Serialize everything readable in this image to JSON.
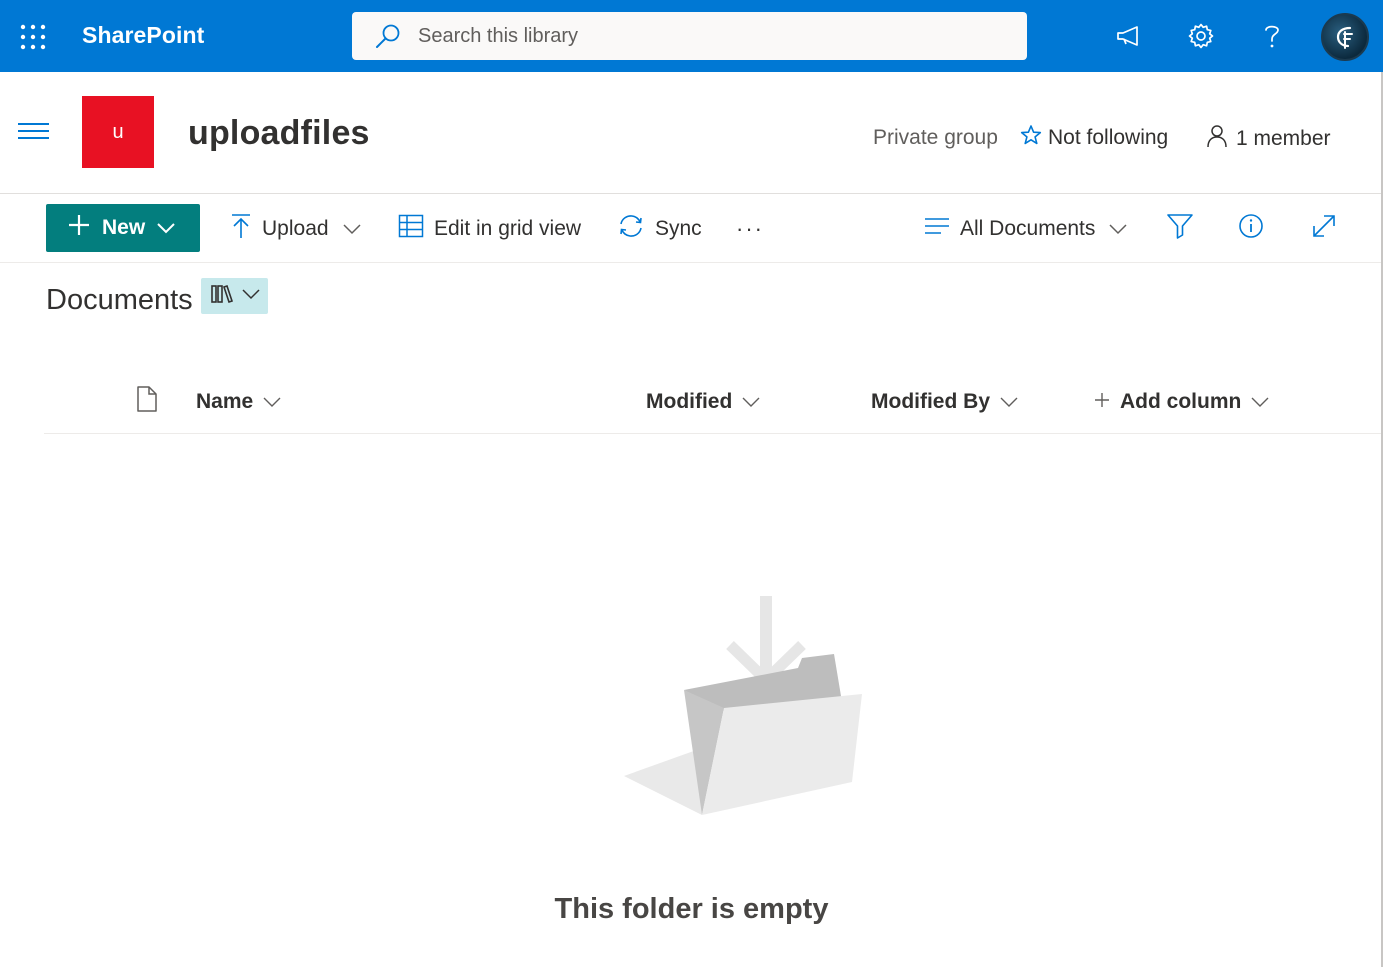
{
  "suite_bar": {
    "app_name": "SharePoint",
    "search_placeholder": "Search this library",
    "icons": [
      "waffle-icon",
      "megaphone-icon",
      "gear-icon",
      "help-icon",
      "avatar"
    ],
    "color": "#0078d4"
  },
  "site_header": {
    "logo_letter": "u",
    "logo_color": "#e81123",
    "title": "uploadfiles",
    "privacy": "Private group",
    "follow_label": "Not following",
    "members_label": "1 member"
  },
  "command_bar": {
    "new_label": "New",
    "new_color": "#037e7e",
    "upload_label": "Upload",
    "grid_label": "Edit in grid view",
    "sync_label": "Sync",
    "more_label": "···",
    "view_label": "All Documents",
    "accent": "#0078d4"
  },
  "library": {
    "title": "Documents",
    "view_switch_color": "#c7e9ec"
  },
  "columns": {
    "name": "Name",
    "modified": "Modified",
    "modified_by": "Modified By",
    "add_column": "Add column"
  },
  "empty_state": {
    "message": "This folder is empty"
  }
}
